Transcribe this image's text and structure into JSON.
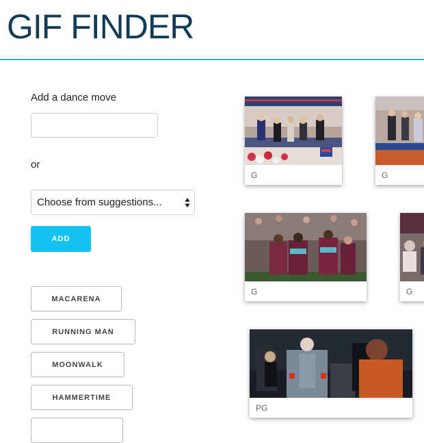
{
  "app": {
    "title": "GIF FINDER"
  },
  "form": {
    "add_label": "Add a dance move",
    "input_value": "",
    "or_label": "or",
    "select_value": "Choose from suggestions...",
    "add_button": "ADD"
  },
  "moves": [
    "MACARENA",
    "RUNNING MAN",
    "MOONWALK",
    "HAMMERTIME"
  ],
  "gifs": [
    {
      "rating": "G"
    },
    {
      "rating": "G"
    },
    {
      "rating": "G"
    },
    {
      "rating": "G"
    },
    {
      "rating": "PG"
    }
  ],
  "colors": {
    "title": "#103c58",
    "rule": "#22b8d8",
    "accent": "#14c3ef"
  },
  "icons": {
    "select_arrows": "up-down-arrows-icon"
  }
}
